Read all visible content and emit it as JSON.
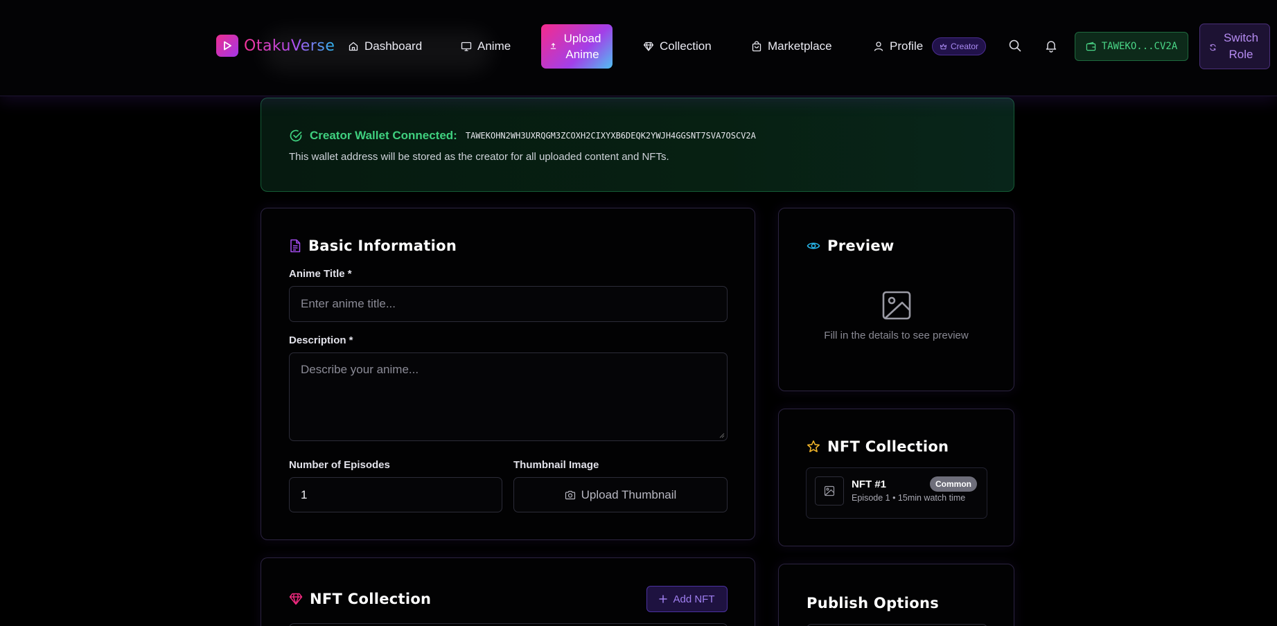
{
  "nav": {
    "brand": "OtakuVerse",
    "items": [
      {
        "label": "Dashboard",
        "icon": "home-icon"
      },
      {
        "label": "Anime",
        "icon": "monitor-icon"
      },
      {
        "label": "Collection",
        "icon": "gem-icon"
      },
      {
        "label": "Marketplace",
        "icon": "shopping-bag-icon"
      },
      {
        "label": "Profile",
        "icon": "user-icon"
      }
    ],
    "upload_label_line1": "Upload",
    "upload_label_line2": "Anime",
    "creator_badge": "Creator",
    "wallet_short": "TAWEKO...CV2A",
    "switch_line1": "Switch",
    "switch_line2": "Role"
  },
  "banner": {
    "label": "Creator Wallet Connected:",
    "address": "TAWEKOHN2WH3UXRQGM3ZCOXH2CIXYXB6DEQK2YWJH4GGSNT7SVA7OSCV2A",
    "description": "This wallet address will be stored as the creator for all uploaded content and NFTs."
  },
  "basic": {
    "title": "Basic Information",
    "anime_title_label": "Anime Title *",
    "anime_title_placeholder": "Enter anime title...",
    "description_label": "Description *",
    "description_placeholder": "Describe your anime...",
    "episodes_label": "Number of Episodes",
    "episodes_value": "1",
    "thumbnail_label": "Thumbnail Image",
    "thumbnail_button": "Upload Thumbnail"
  },
  "preview": {
    "title": "Preview",
    "empty_text": "Fill in the details to see preview"
  },
  "nft_side": {
    "title": "NFT Collection",
    "item_name": "NFT #1",
    "item_meta": "Episode 1 • 15min watch time",
    "item_rarity": "Common"
  },
  "nft_main": {
    "title": "NFT Collection",
    "add_button": "Add NFT"
  },
  "publish": {
    "title": "Publish Options"
  },
  "colors": {
    "accent_pink": "#f52b8c",
    "accent_purple": "#a33fe8",
    "accent_cyan": "#4fc0f2",
    "success_green": "#3fd07f"
  }
}
